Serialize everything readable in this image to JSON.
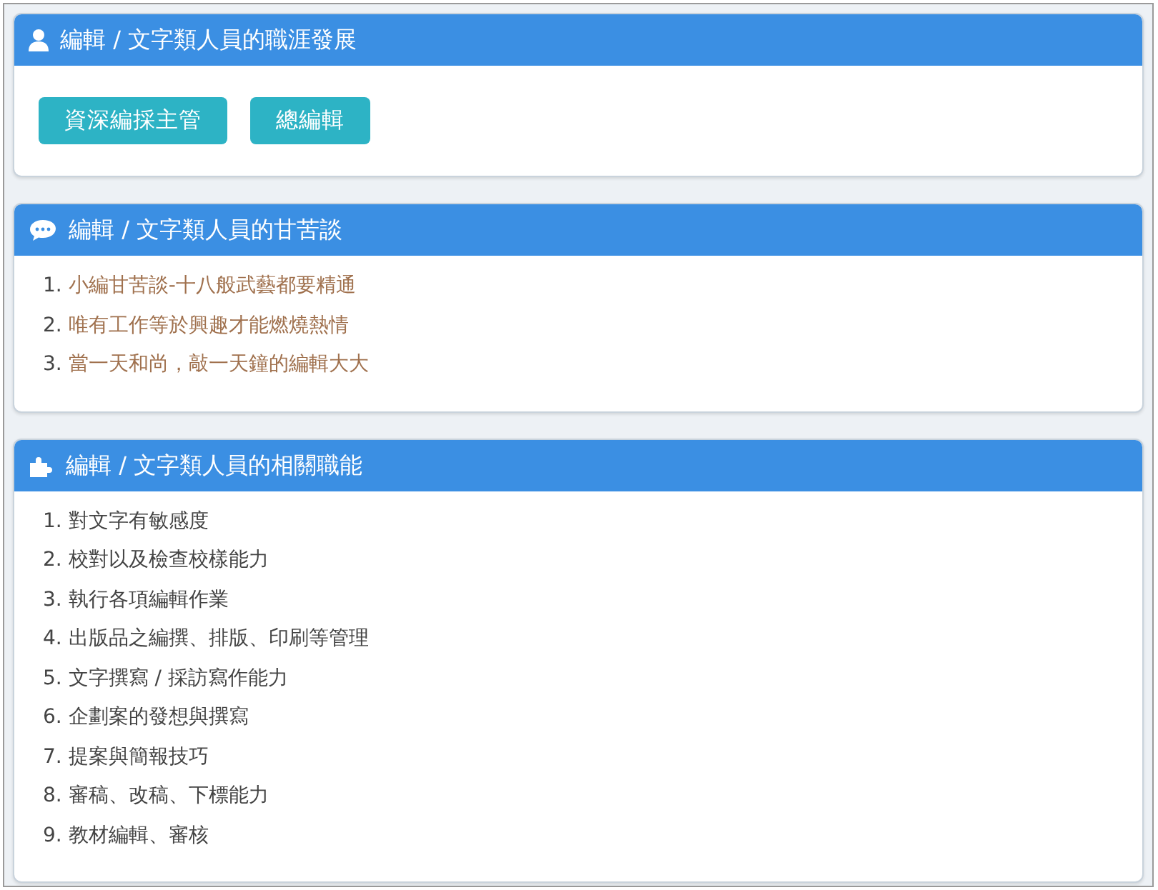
{
  "panels": [
    {
      "title": "編輯 / 文字類人員的職涯發展",
      "kind": "buttons",
      "buttons": [
        "資深編採主管",
        "總編輯"
      ]
    },
    {
      "title": "編輯 / 文字類人員的甘苦談",
      "kind": "links",
      "items": [
        {
          "number": "1.",
          "text": "小編甘苦談-十八般武藝都要精通"
        },
        {
          "number": "2.",
          "text": "唯有工作等於興趣才能燃燒熱情"
        },
        {
          "number": "3.",
          "text": "當一天和尚，敲一天鐘的編輯大大"
        }
      ]
    },
    {
      "title": "編輯 / 文字類人員的相關職能",
      "kind": "list",
      "items": [
        {
          "number": "1.",
          "text": "對文字有敏感度"
        },
        {
          "number": "2.",
          "text": "校對以及檢查校樣能力"
        },
        {
          "number": "3.",
          "text": "執行各項編輯作業"
        },
        {
          "number": "4.",
          "text": "出版品之編撰、排版、印刷等管理"
        },
        {
          "number": "5.",
          "text": "文字撰寫 / 採訪寫作能力"
        },
        {
          "number": "6.",
          "text": "企劃案的發想與撰寫"
        },
        {
          "number": "7.",
          "text": "提案與簡報技巧"
        },
        {
          "number": "8.",
          "text": "審稿、改稿、下標能力"
        },
        {
          "number": "9.",
          "text": "教材編輯、審核"
        }
      ]
    }
  ]
}
